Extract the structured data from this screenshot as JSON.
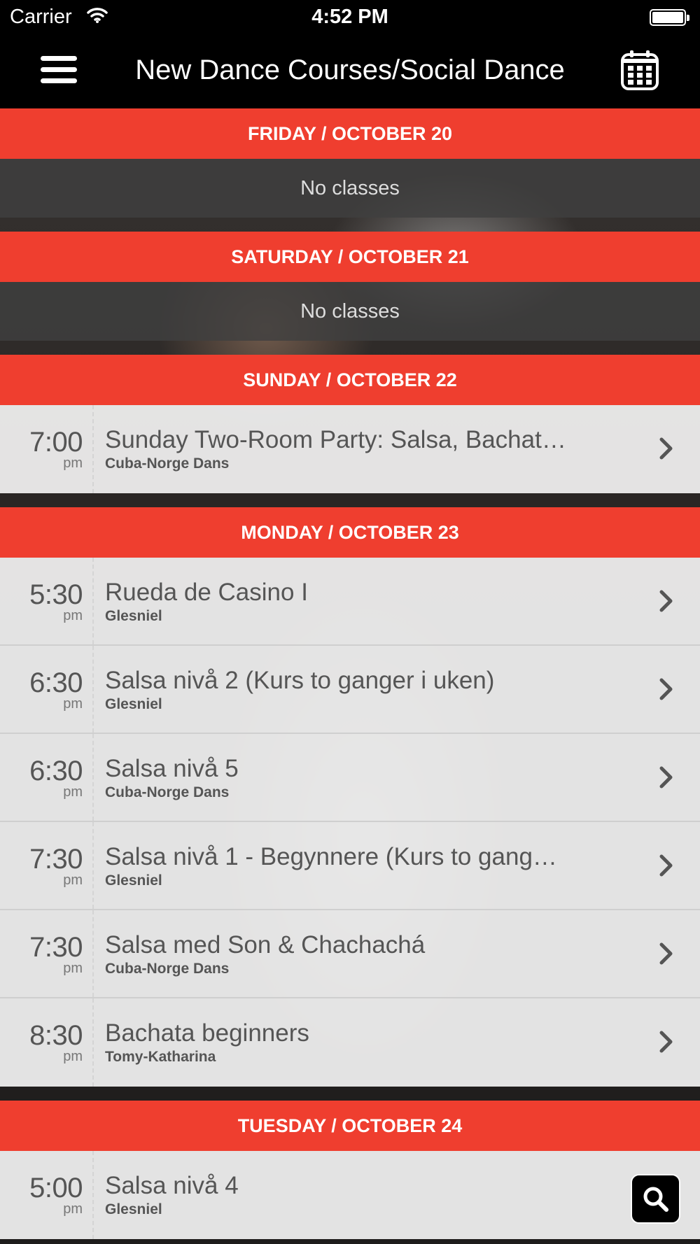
{
  "status_bar": {
    "carrier": "Carrier",
    "time": "4:52 PM"
  },
  "nav": {
    "title": "New Dance Courses/Social Dance",
    "menu_icon": "hamburger-menu-icon",
    "calendar_icon": "calendar-icon"
  },
  "colors": {
    "header_bg": "#000000",
    "day_header_bg": "#ef3e2f",
    "row_bg": "#f2f2f2"
  },
  "days": [
    {
      "label": "FRIDAY / OCTOBER 20",
      "empty_text": "No classes",
      "classes": []
    },
    {
      "label": "SATURDAY / OCTOBER 21",
      "empty_text": "No classes",
      "classes": []
    },
    {
      "label": "SUNDAY / OCTOBER 22",
      "classes": [
        {
          "time": "7:00",
          "ampm": "pm",
          "title": "Sunday Two-Room Party: Salsa, Bachat…",
          "instructor": "Cuba-Norge Dans"
        }
      ]
    },
    {
      "label": "MONDAY / OCTOBER 23",
      "classes": [
        {
          "time": "5:30",
          "ampm": "pm",
          "title": "Rueda de Casino I",
          "instructor": "Glesniel"
        },
        {
          "time": "6:30",
          "ampm": "pm",
          "title": "Salsa nivå 2 (Kurs to ganger i uken)",
          "instructor": "Glesniel"
        },
        {
          "time": "6:30",
          "ampm": "pm",
          "title": "Salsa nivå 5",
          "instructor": "Cuba-Norge Dans"
        },
        {
          "time": "7:30",
          "ampm": "pm",
          "title": "Salsa nivå 1 - Begynnere (Kurs to gang…",
          "instructor": "Glesniel"
        },
        {
          "time": "7:30",
          "ampm": "pm",
          "title": "Salsa med Son & Chachachá",
          "instructor": "Cuba-Norge Dans"
        },
        {
          "time": "8:30",
          "ampm": "pm",
          "title": "Bachata beginners",
          "instructor": "Tomy-Katharina"
        }
      ]
    },
    {
      "label": "TUESDAY / OCTOBER 24",
      "classes": [
        {
          "time": "5:00",
          "ampm": "pm",
          "title": "Salsa nivå 4",
          "instructor": "Glesniel"
        }
      ]
    }
  ],
  "search_icon": "search-icon"
}
